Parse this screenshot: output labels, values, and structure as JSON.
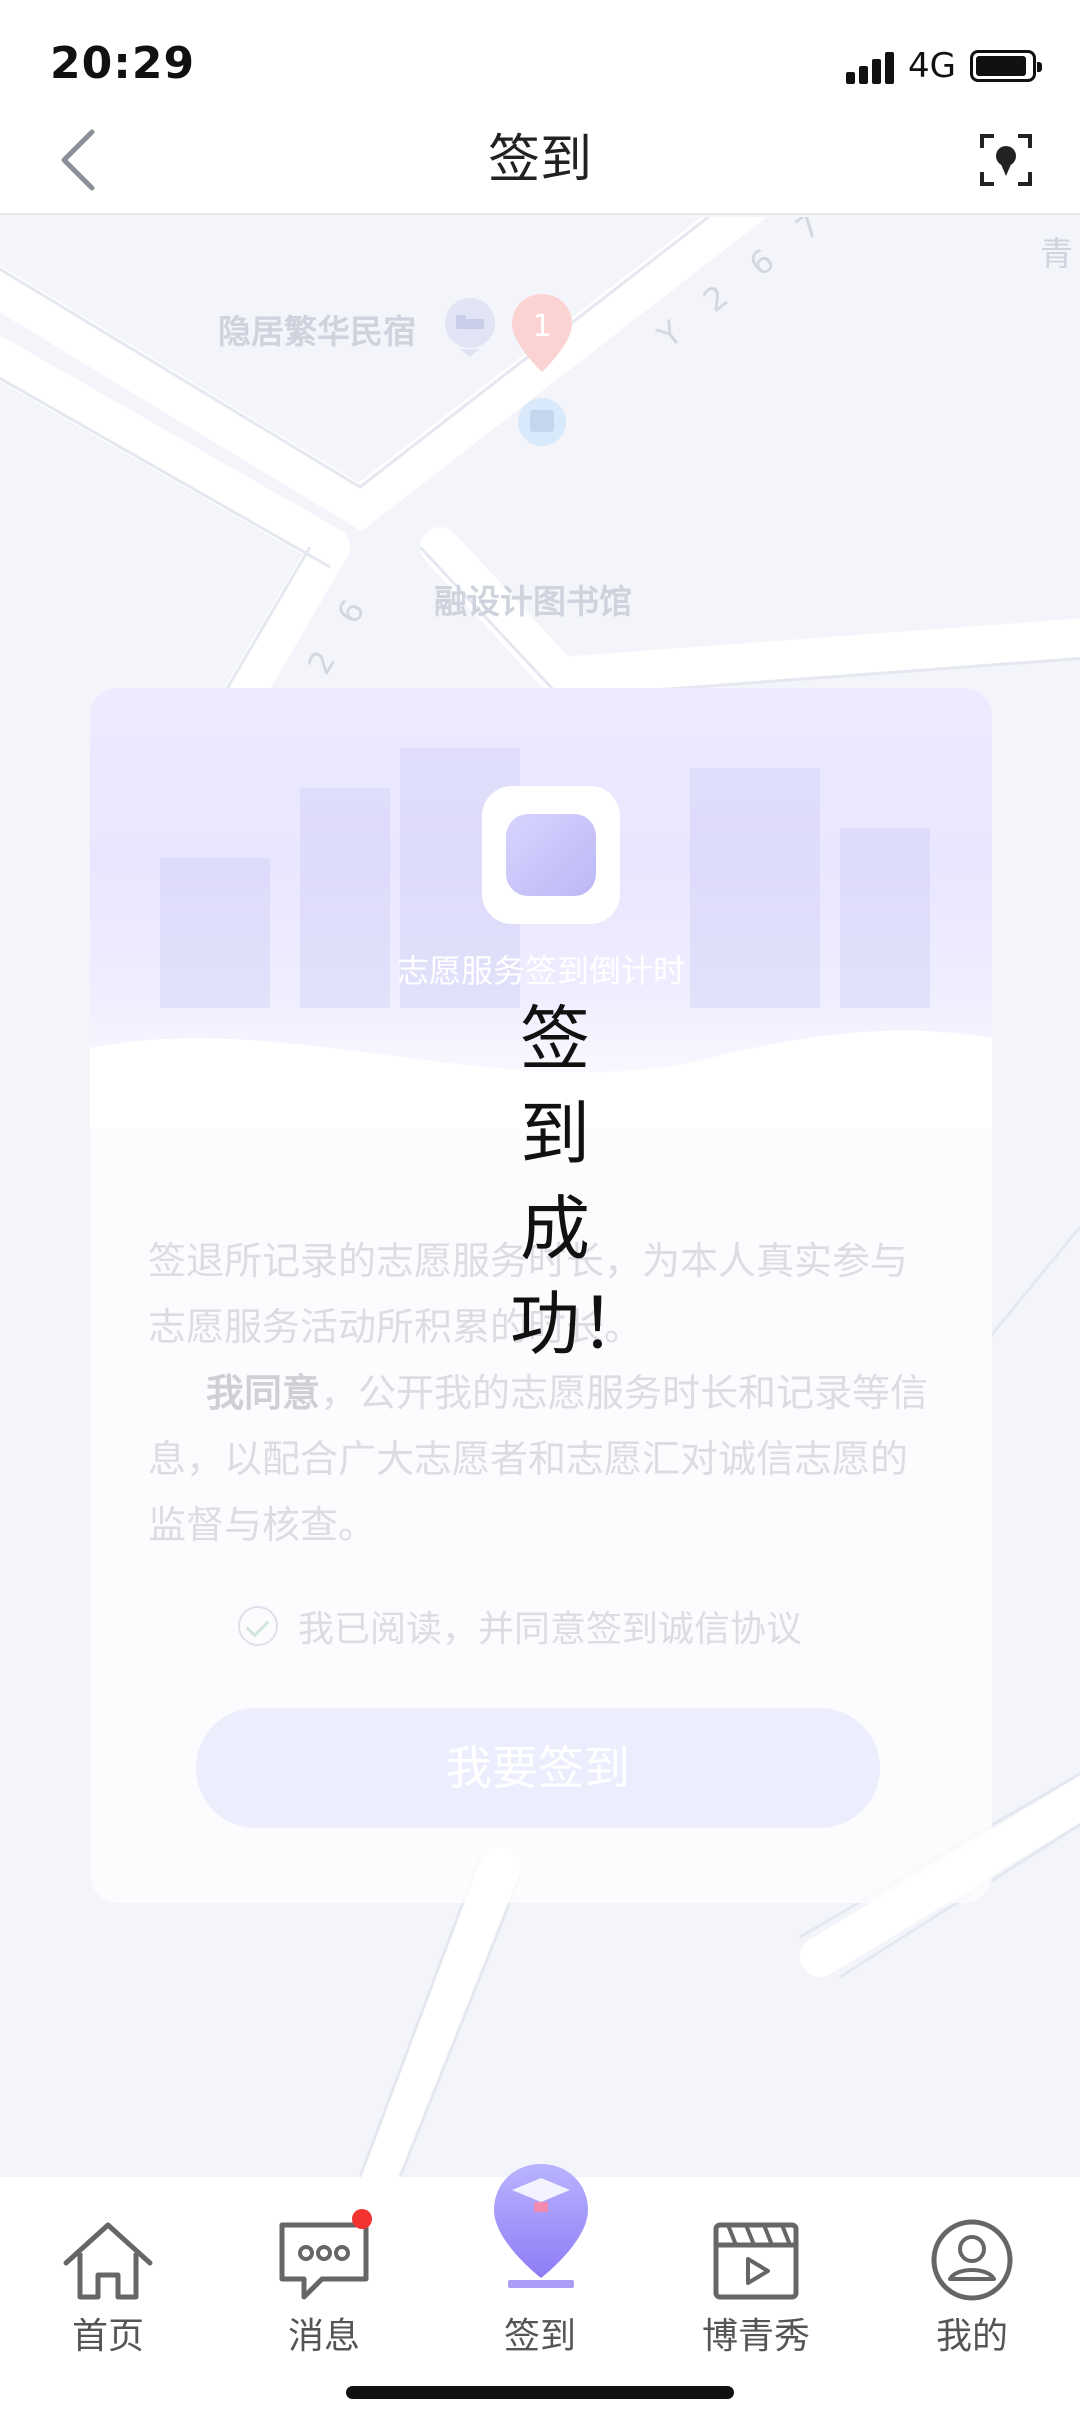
{
  "status_bar": {
    "time": "20:29",
    "network": "4G"
  },
  "nav": {
    "title": "签到",
    "back_icon": "chevron-left-icon",
    "locate_icon": "locate-icon"
  },
  "map": {
    "pois": [
      {
        "name": "隐居繁华民宿",
        "icon": "hotel-icon"
      },
      {
        "name": "融设计图书馆",
        "icon": "library-icon",
        "marker_number": "1"
      }
    ],
    "road_labels": [
      "Y 2 6 7",
      "Y 2 6"
    ],
    "edge_label": "青"
  },
  "card": {
    "countdown_label": "志愿服务签到倒计时",
    "paragraph_1": "签退所记录的志愿服务时长，为本人真实参与志愿服务活动所积累的时长。",
    "paragraph_2_bold": "我同意",
    "paragraph_2_rest": "，公开我的志愿服务时长和记录等信息，以配合广大志愿者和志愿汇对诚信志愿的监督与核查。",
    "agree_text": "我已阅读，并同意签到诚信协议",
    "agreed": true,
    "signin_button": "我要签到"
  },
  "toast": {
    "message": "签到成功！"
  },
  "tab_bar": {
    "items": [
      {
        "label": "首页",
        "icon": "home-icon"
      },
      {
        "label": "消息",
        "icon": "message-icon",
        "badge": true
      },
      {
        "label": "签到",
        "icon": "checkin-icon",
        "active": true
      },
      {
        "label": "博青秀",
        "icon": "video-icon"
      },
      {
        "label": "我的",
        "icon": "profile-icon"
      }
    ]
  },
  "colors": {
    "badge": "#f33232",
    "accent": "#8e7cf6"
  }
}
